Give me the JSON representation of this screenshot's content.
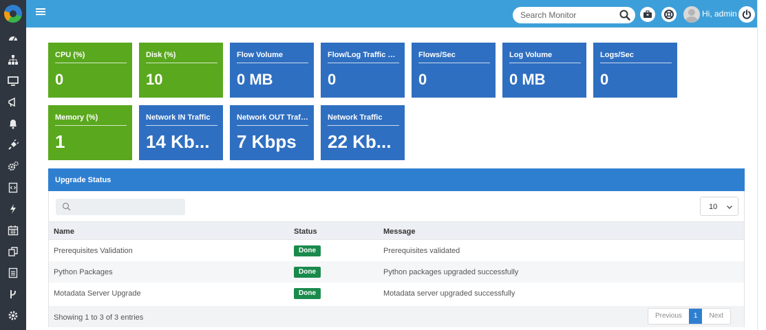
{
  "header": {
    "search_placeholder": "Search Monitor",
    "greeting": "Hi, admin",
    "icons": [
      "search-icon",
      "briefcase-icon",
      "lifebuoy-icon",
      "user-avatar",
      "power-icon"
    ]
  },
  "sidebar": {
    "items": [
      {
        "icon": "dashboard-icon"
      },
      {
        "icon": "sitemap-icon"
      },
      {
        "icon": "desktop-icon"
      },
      {
        "icon": "megaphone-icon"
      },
      {
        "icon": "bell-icon"
      },
      {
        "icon": "plug-icon"
      },
      {
        "icon": "cogs-icon"
      },
      {
        "icon": "code-file-icon"
      },
      {
        "icon": "bolt-icon"
      },
      {
        "icon": "calendar-icon"
      },
      {
        "icon": "copy-icon"
      },
      {
        "icon": "document-icon"
      },
      {
        "icon": "branch-icon"
      },
      {
        "icon": "settings-icon"
      }
    ]
  },
  "tiles": [
    {
      "label": "CPU (%)",
      "value": "0",
      "color": "#5aa81e"
    },
    {
      "label": "Disk (%)",
      "value": "10",
      "color": "#5aa81e"
    },
    {
      "label": "Flow Volume",
      "value": "0 MB",
      "color": "#2f6fc1"
    },
    {
      "label": "Flow/Log Traffic Us...",
      "value": "0",
      "color": "#2f6fc1"
    },
    {
      "label": "Flows/Sec",
      "value": "0",
      "color": "#2f6fc1"
    },
    {
      "label": "Log Volume",
      "value": "0 MB",
      "color": "#2f6fc1"
    },
    {
      "label": "Logs/Sec",
      "value": "0",
      "color": "#2f6fc1"
    },
    {
      "label": "Memory (%)",
      "value": "1",
      "color": "#5aa81e"
    },
    {
      "label": "Network IN Traffic",
      "value": "14 Kb...",
      "color": "#2f6fc1"
    },
    {
      "label": "Network OUT Traffic",
      "value": "7 Kbps",
      "color": "#2f6fc1"
    },
    {
      "label": "Network Traffic",
      "value": "22 Kb...",
      "color": "#2f6fc1"
    }
  ],
  "upgrade": {
    "title": "Upgrade Status",
    "filter_placeholder": "",
    "page_size": "10",
    "columns": [
      "Name",
      "Status",
      "Message"
    ],
    "rows": [
      {
        "name": "Prerequisites Validation",
        "status": "Done",
        "message": "Prerequisites validated"
      },
      {
        "name": "Python Packages",
        "status": "Done",
        "message": "Python packages upgraded successfully"
      },
      {
        "name": "Motadata Server Upgrade",
        "status": "Done",
        "message": "Motadata server upgraded successfully"
      }
    ],
    "summary": "Showing 1 to 3 of 3 entries",
    "pager": {
      "previous": "Previous",
      "current": "1",
      "next": "Next"
    }
  },
  "colors": {
    "topbar": "#3d9fd9",
    "sidebar": "#2f3640",
    "tile_green": "#5aa81e",
    "tile_blue": "#2f6fc1",
    "panel_header": "#2f7fd1",
    "badge_done": "#1a8a4c"
  }
}
